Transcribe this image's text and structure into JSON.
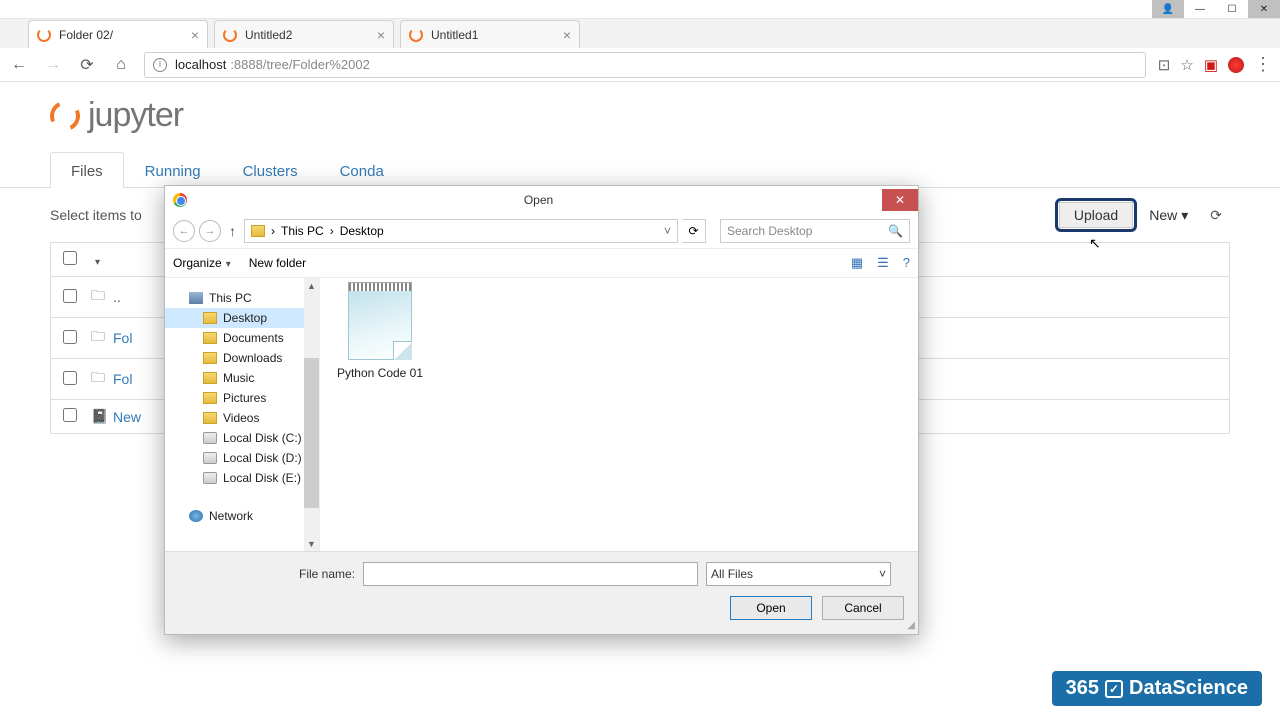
{
  "os": {
    "user_icon": "👤",
    "minimize": "—",
    "maximize": "☐",
    "close": "✕"
  },
  "browser": {
    "tabs": [
      {
        "label": "Folder 02/"
      },
      {
        "label": "Untitled2"
      },
      {
        "label": "Untitled1"
      }
    ],
    "close_x": "×",
    "url_host": "localhost",
    "url_port_path": ":8888/tree/Folder%2002",
    "info": "i",
    "star": "☆",
    "zoom": "⊡",
    "menu_dots": "⋮"
  },
  "jupyter": {
    "brand": "jupyter",
    "tabs": {
      "files": "Files",
      "running": "Running",
      "clusters": "Clusters",
      "conda": "Conda"
    },
    "select_text": "Select items to",
    "upload": "Upload",
    "new": "New",
    "refresh": "⟳",
    "header_caret": "▾",
    "items": [
      {
        "icon": "📁",
        "name": "..",
        "black": true
      },
      {
        "icon": "📁",
        "name": "Fol"
      },
      {
        "icon": "📁",
        "name": "Fol"
      },
      {
        "icon": "📓",
        "name": "New"
      }
    ]
  },
  "dialog": {
    "title": "Open",
    "back": "←",
    "fwd": "→",
    "up": "↑",
    "path": [
      "This PC",
      "Desktop"
    ],
    "path_sep": "›",
    "refresh": "⟳",
    "search_placeholder": "Search Desktop",
    "search_icon": "🔍",
    "organize": "Organize",
    "new_folder": "New folder",
    "view_icons": [
      "▦",
      "☰",
      "?"
    ],
    "sidebar": [
      {
        "label": "This PC",
        "ico": "pc",
        "indent": 0
      },
      {
        "label": "Desktop",
        "ico": "fold",
        "indent": 1,
        "sel": true
      },
      {
        "label": "Documents",
        "ico": "fold",
        "indent": 1
      },
      {
        "label": "Downloads",
        "ico": "fold",
        "indent": 1
      },
      {
        "label": "Music",
        "ico": "fold",
        "indent": 1
      },
      {
        "label": "Pictures",
        "ico": "fold",
        "indent": 1
      },
      {
        "label": "Videos",
        "ico": "fold",
        "indent": 1
      },
      {
        "label": "Local Disk (C:)",
        "ico": "disk",
        "indent": 1
      },
      {
        "label": "Local Disk (D:)",
        "ico": "disk",
        "indent": 1
      },
      {
        "label": "Local Disk (E:)",
        "ico": "disk",
        "indent": 1
      },
      {
        "label": "Network",
        "ico": "net",
        "indent": 0
      }
    ],
    "file": "Python Code 01",
    "filename_label": "File name:",
    "filename_value": "",
    "filter": "All Files",
    "open": "Open",
    "cancel": "Cancel"
  },
  "watermark": {
    "num": "365",
    "check": "✓",
    "text": "DataScience"
  }
}
